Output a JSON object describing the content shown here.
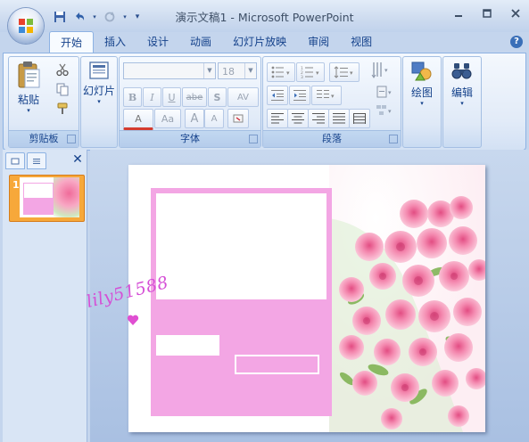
{
  "window": {
    "title": "演示文稿1 - Microsoft PowerPoint",
    "controls": [
      "minimize",
      "maximize",
      "close"
    ]
  },
  "qat": {
    "icons": [
      "save-icon",
      "undo-icon",
      "redo-icon",
      "customize-icon"
    ]
  },
  "tabs": [
    {
      "label": "开始",
      "active": true
    },
    {
      "label": "插入",
      "active": false
    },
    {
      "label": "设计",
      "active": false
    },
    {
      "label": "动画",
      "active": false
    },
    {
      "label": "幻灯片放映",
      "active": false
    },
    {
      "label": "审阅",
      "active": false
    },
    {
      "label": "视图",
      "active": false
    }
  ],
  "ribbon": {
    "clipboard": {
      "label": "剪贴板",
      "paste": "粘贴"
    },
    "slides": {
      "new_slide": "幻灯片"
    },
    "font": {
      "label": "字体",
      "font_name": "",
      "font_size": "18",
      "buttons": [
        "B",
        "I",
        "U",
        "abe",
        "S",
        "AV",
        "A",
        "Aa",
        "A",
        "A"
      ]
    },
    "paragraph": {
      "label": "段落"
    },
    "drawing": {
      "label": "绘图"
    },
    "editing": {
      "label": "编辑"
    }
  },
  "slides_pane": {
    "slide_number": "1"
  },
  "watermark": "lily51588",
  "colors": {
    "accent": "#f3a6e4",
    "ribbon": "#dfe9f7",
    "thumb_selected": "#f7a83a"
  }
}
